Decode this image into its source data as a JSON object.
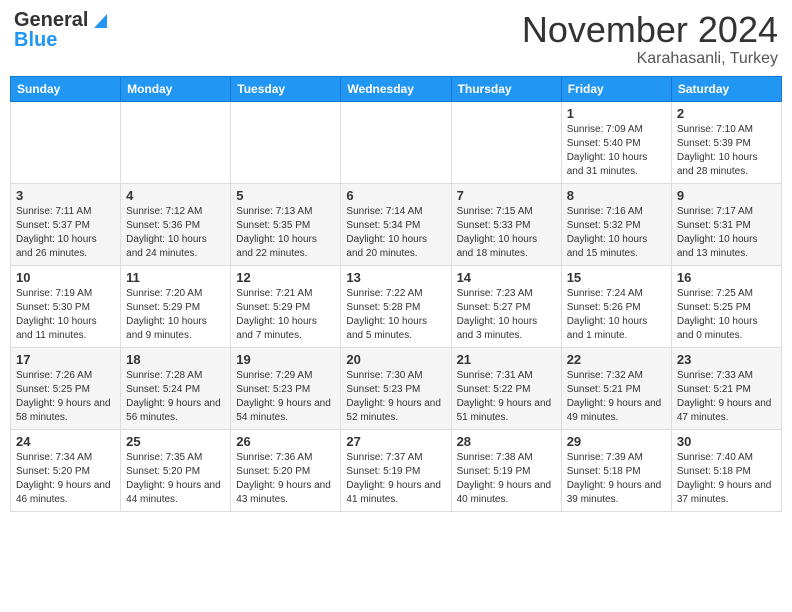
{
  "header": {
    "logo_general": "General",
    "logo_blue": "Blue",
    "month_title": "November 2024",
    "subtitle": "Karahasanli, Turkey"
  },
  "days_of_week": [
    "Sunday",
    "Monday",
    "Tuesday",
    "Wednesday",
    "Thursday",
    "Friday",
    "Saturday"
  ],
  "weeks": [
    [
      {
        "day": "",
        "info": ""
      },
      {
        "day": "",
        "info": ""
      },
      {
        "day": "",
        "info": ""
      },
      {
        "day": "",
        "info": ""
      },
      {
        "day": "",
        "info": ""
      },
      {
        "day": "1",
        "info": "Sunrise: 7:09 AM\nSunset: 5:40 PM\nDaylight: 10 hours and 31 minutes."
      },
      {
        "day": "2",
        "info": "Sunrise: 7:10 AM\nSunset: 5:39 PM\nDaylight: 10 hours and 28 minutes."
      }
    ],
    [
      {
        "day": "3",
        "info": "Sunrise: 7:11 AM\nSunset: 5:37 PM\nDaylight: 10 hours and 26 minutes."
      },
      {
        "day": "4",
        "info": "Sunrise: 7:12 AM\nSunset: 5:36 PM\nDaylight: 10 hours and 24 minutes."
      },
      {
        "day": "5",
        "info": "Sunrise: 7:13 AM\nSunset: 5:35 PM\nDaylight: 10 hours and 22 minutes."
      },
      {
        "day": "6",
        "info": "Sunrise: 7:14 AM\nSunset: 5:34 PM\nDaylight: 10 hours and 20 minutes."
      },
      {
        "day": "7",
        "info": "Sunrise: 7:15 AM\nSunset: 5:33 PM\nDaylight: 10 hours and 18 minutes."
      },
      {
        "day": "8",
        "info": "Sunrise: 7:16 AM\nSunset: 5:32 PM\nDaylight: 10 hours and 15 minutes."
      },
      {
        "day": "9",
        "info": "Sunrise: 7:17 AM\nSunset: 5:31 PM\nDaylight: 10 hours and 13 minutes."
      }
    ],
    [
      {
        "day": "10",
        "info": "Sunrise: 7:19 AM\nSunset: 5:30 PM\nDaylight: 10 hours and 11 minutes."
      },
      {
        "day": "11",
        "info": "Sunrise: 7:20 AM\nSunset: 5:29 PM\nDaylight: 10 hours and 9 minutes."
      },
      {
        "day": "12",
        "info": "Sunrise: 7:21 AM\nSunset: 5:29 PM\nDaylight: 10 hours and 7 minutes."
      },
      {
        "day": "13",
        "info": "Sunrise: 7:22 AM\nSunset: 5:28 PM\nDaylight: 10 hours and 5 minutes."
      },
      {
        "day": "14",
        "info": "Sunrise: 7:23 AM\nSunset: 5:27 PM\nDaylight: 10 hours and 3 minutes."
      },
      {
        "day": "15",
        "info": "Sunrise: 7:24 AM\nSunset: 5:26 PM\nDaylight: 10 hours and 1 minute."
      },
      {
        "day": "16",
        "info": "Sunrise: 7:25 AM\nSunset: 5:25 PM\nDaylight: 10 hours and 0 minutes."
      }
    ],
    [
      {
        "day": "17",
        "info": "Sunrise: 7:26 AM\nSunset: 5:25 PM\nDaylight: 9 hours and 58 minutes."
      },
      {
        "day": "18",
        "info": "Sunrise: 7:28 AM\nSunset: 5:24 PM\nDaylight: 9 hours and 56 minutes."
      },
      {
        "day": "19",
        "info": "Sunrise: 7:29 AM\nSunset: 5:23 PM\nDaylight: 9 hours and 54 minutes."
      },
      {
        "day": "20",
        "info": "Sunrise: 7:30 AM\nSunset: 5:23 PM\nDaylight: 9 hours and 52 minutes."
      },
      {
        "day": "21",
        "info": "Sunrise: 7:31 AM\nSunset: 5:22 PM\nDaylight: 9 hours and 51 minutes."
      },
      {
        "day": "22",
        "info": "Sunrise: 7:32 AM\nSunset: 5:21 PM\nDaylight: 9 hours and 49 minutes."
      },
      {
        "day": "23",
        "info": "Sunrise: 7:33 AM\nSunset: 5:21 PM\nDaylight: 9 hours and 47 minutes."
      }
    ],
    [
      {
        "day": "24",
        "info": "Sunrise: 7:34 AM\nSunset: 5:20 PM\nDaylight: 9 hours and 46 minutes."
      },
      {
        "day": "25",
        "info": "Sunrise: 7:35 AM\nSunset: 5:20 PM\nDaylight: 9 hours and 44 minutes."
      },
      {
        "day": "26",
        "info": "Sunrise: 7:36 AM\nSunset: 5:20 PM\nDaylight: 9 hours and 43 minutes."
      },
      {
        "day": "27",
        "info": "Sunrise: 7:37 AM\nSunset: 5:19 PM\nDaylight: 9 hours and 41 minutes."
      },
      {
        "day": "28",
        "info": "Sunrise: 7:38 AM\nSunset: 5:19 PM\nDaylight: 9 hours and 40 minutes."
      },
      {
        "day": "29",
        "info": "Sunrise: 7:39 AM\nSunset: 5:18 PM\nDaylight: 9 hours and 39 minutes."
      },
      {
        "day": "30",
        "info": "Sunrise: 7:40 AM\nSunset: 5:18 PM\nDaylight: 9 hours and 37 minutes."
      }
    ]
  ]
}
